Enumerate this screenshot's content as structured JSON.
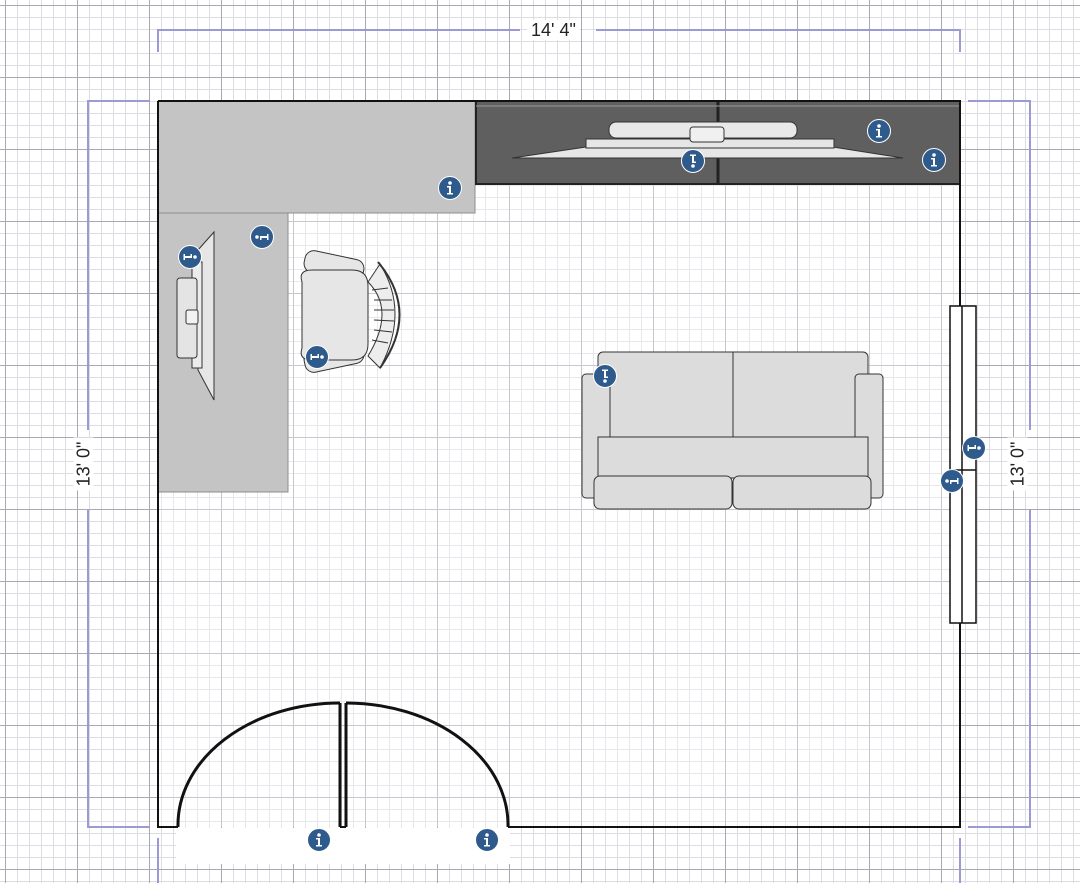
{
  "dimensions": {
    "width_label": "14' 4\"",
    "left_height_label": "13' 0\"",
    "right_height_label": "13' 0\""
  },
  "colors": {
    "dimension_line": "#9a9ad6",
    "wall": "#111111",
    "counter": "#c4c4c4",
    "cabinet": "#5f5f5f",
    "furniture_fill": "#dcdcdc",
    "info_badge": "#2f5b8c"
  },
  "info_badges": [
    {
      "id": "counter",
      "icon": "info-icon"
    },
    {
      "id": "tv",
      "icon": "info-icon"
    },
    {
      "id": "cabinet-top",
      "icon": "info-icon"
    },
    {
      "id": "cabinet-right",
      "icon": "info-icon"
    },
    {
      "id": "desk",
      "icon": "info-icon"
    },
    {
      "id": "monitor",
      "icon": "info-icon"
    },
    {
      "id": "chair",
      "icon": "info-icon"
    },
    {
      "id": "sofa",
      "icon": "info-icon"
    },
    {
      "id": "window-a",
      "icon": "info-icon"
    },
    {
      "id": "window-b",
      "icon": "info-icon"
    },
    {
      "id": "door-left",
      "icon": "info-icon"
    },
    {
      "id": "door-right",
      "icon": "info-icon"
    }
  ]
}
